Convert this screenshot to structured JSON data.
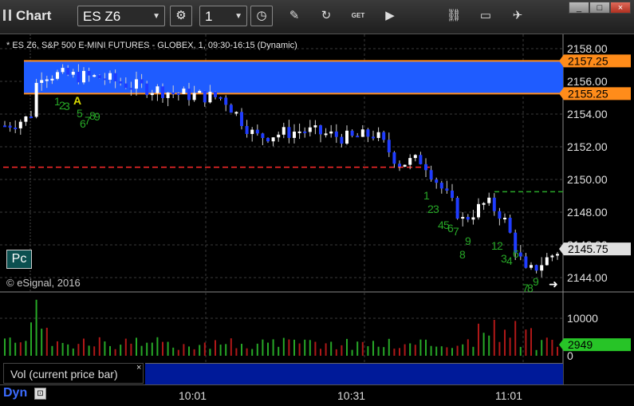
{
  "window": {
    "title": "Chart",
    "minimize": "_",
    "maximize": "□",
    "close": "×"
  },
  "toolbar": {
    "symbol": "ES Z6",
    "interval": "1",
    "icons": [
      "settings-gear-icon",
      "clock-icon",
      "pencil-icon",
      "refresh-icon",
      "get-icon",
      "play-icon",
      "link-icon",
      "chat-icon",
      "twitter-icon"
    ],
    "get_label": "GET"
  },
  "chart": {
    "header": "* ES Z6, S&P 500 E-MINI FUTURES - GLOBEX, 1, 09:30-16:15 (Dynamic)",
    "copyright": "© eSignal, 2016",
    "price_ticks": [
      "2158.00",
      "2156.00",
      "2154.00",
      "2152.00",
      "2150.00",
      "2148.00",
      "2146.00",
      "2144.00"
    ],
    "price_markers": [
      {
        "label": "2157.25",
        "value": 2157.25,
        "color": "#ff8c1a"
      },
      {
        "label": "2155.25",
        "value": 2155.25,
        "color": "#ff8c1a"
      },
      {
        "label": "2145.75",
        "value": 2145.75,
        "color": "#e0e0e0"
      }
    ],
    "zone": {
      "top": 2157.25,
      "bottom": 2155.25,
      "color": "#1f5cff"
    },
    "red_line": 2150.75,
    "green_line": 2149.25,
    "time_labels": [
      "10:01",
      "10:31",
      "11:01"
    ],
    "pc_label": "Pc",
    "annotation_A": "A"
  },
  "volume": {
    "ticks": [
      "10000",
      "0"
    ],
    "current_label": "2949",
    "study_label": "Vol (current price bar)",
    "close_glyph": "×"
  },
  "footer": {
    "mode": "Dyn",
    "lock": "🔒"
  },
  "colors": {
    "up": "#ffffff",
    "down": "#1f3cff",
    "vol_up": "#27a827",
    "vol_down": "#b01818",
    "grid": "#3a3a3a"
  }
}
